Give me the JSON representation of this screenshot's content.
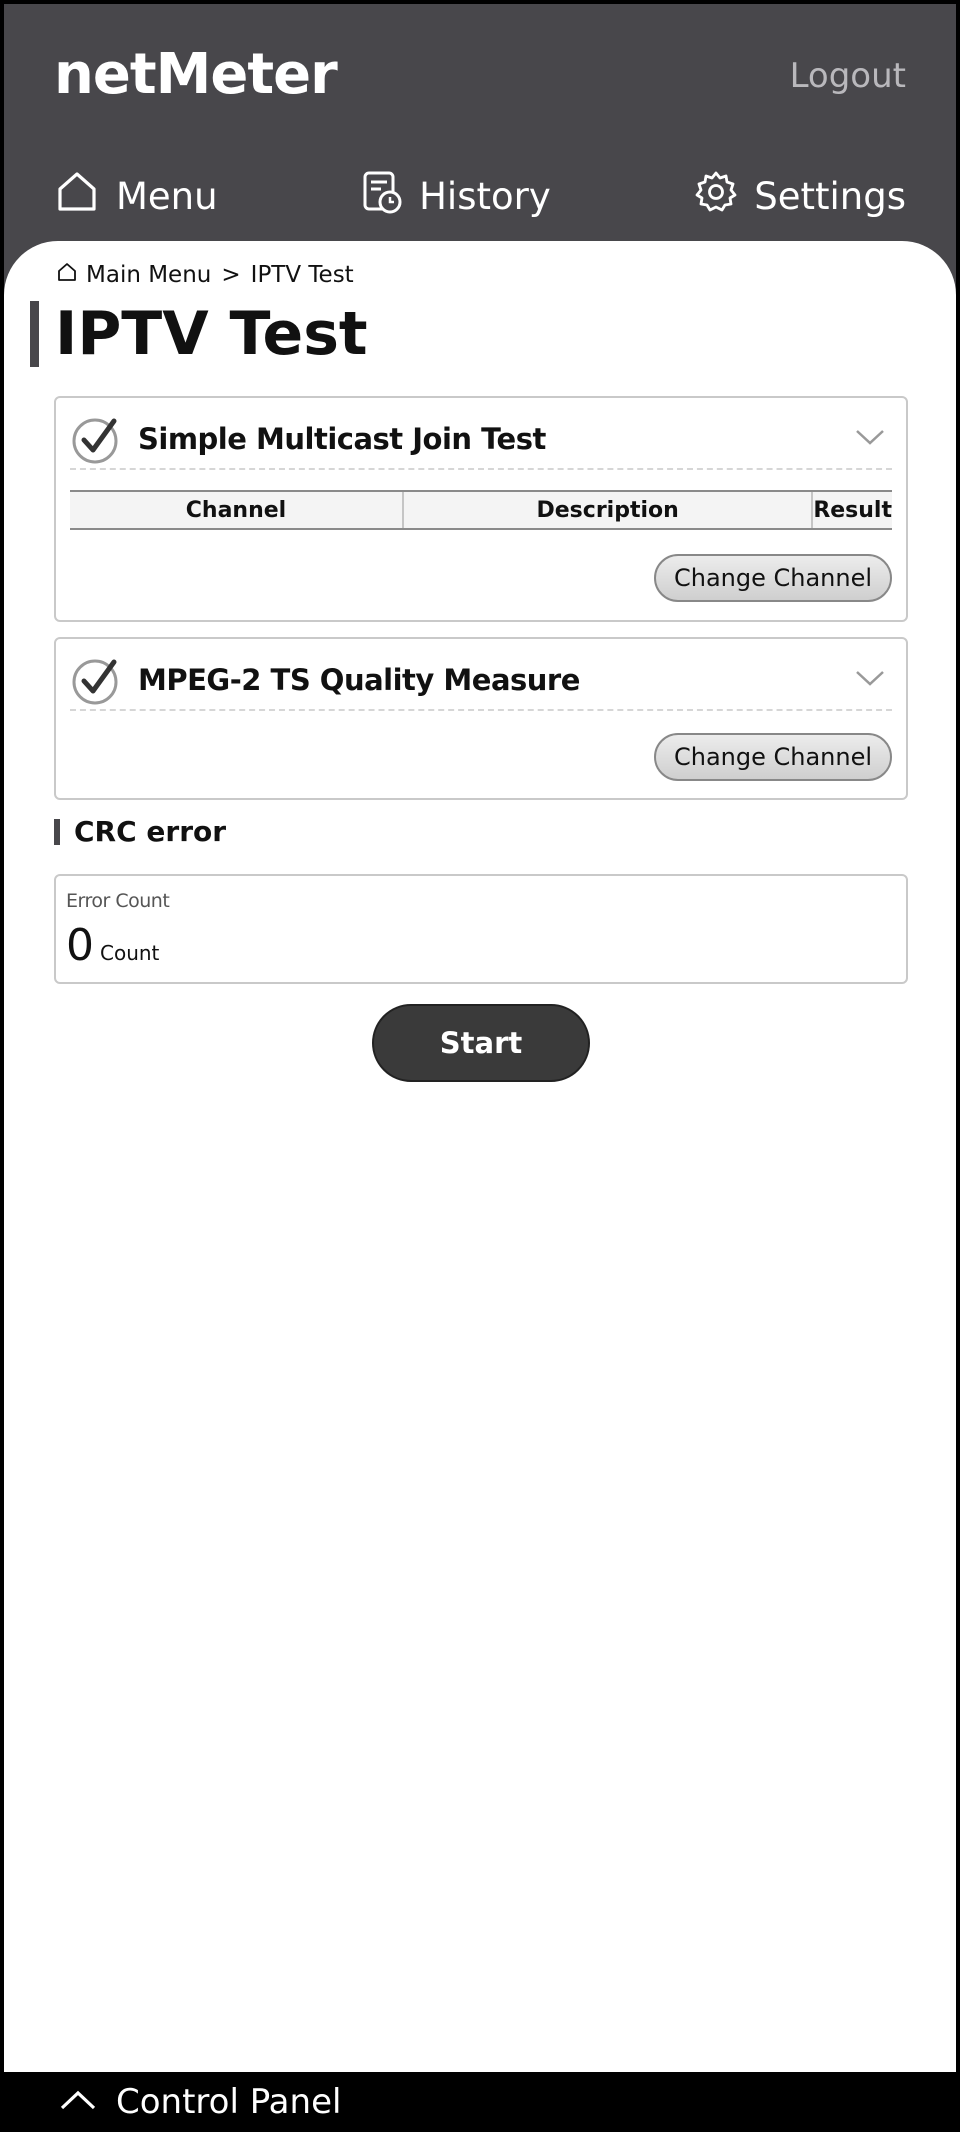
{
  "app": {
    "logo": "netMeter",
    "logout_label": "Logout"
  },
  "nav": {
    "menu_label": "Menu",
    "history_label": "History",
    "settings_label": "Settings"
  },
  "breadcrumb": {
    "root": "Main Menu",
    "separator": ">",
    "current": "IPTV Test"
  },
  "page": {
    "title": "IPTV Test"
  },
  "tests": [
    {
      "title": "Simple Multicast Join Test",
      "checked": true,
      "table_headers": [
        "Channel",
        "Description",
        "Result"
      ],
      "button_label": "Change Channel"
    },
    {
      "title": "MPEG-2 TS Quality Measure",
      "checked": true,
      "button_label": "Change Channel"
    }
  ],
  "crc": {
    "section_title": "CRC error",
    "label": "Error Count",
    "value": "0",
    "unit": "Count"
  },
  "start_label": "Start",
  "control_panel_label": "Control Panel",
  "icons": {
    "home": "home-icon",
    "history": "history-icon",
    "settings": "gear-icon",
    "check": "check-circle-icon",
    "chevron": "chevron-down-icon",
    "control_panel": "chevron-up-icon"
  },
  "colors": {
    "header_bg": "#48474b",
    "content_bg": "#ffffff",
    "start_button": "#3a3a3a"
  }
}
